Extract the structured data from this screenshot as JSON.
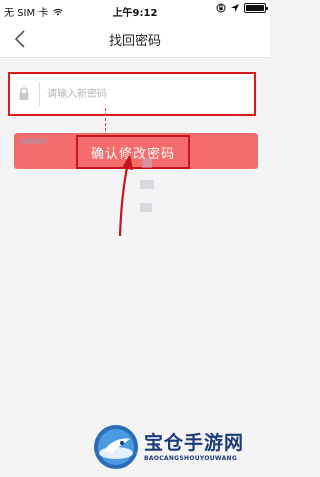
{
  "status_bar": {
    "carrier": "无 SIM 卡",
    "time": "上午9:12",
    "icons": [
      "wifi-icon",
      "rotation-lock-icon",
      "location-icon",
      "battery-icon"
    ]
  },
  "nav": {
    "back_icon": "chevron-left-icon",
    "title": "找回密码"
  },
  "password_field": {
    "icon": "lock-icon",
    "placeholder": "请输入新密码",
    "value": ""
  },
  "confirm_button": {
    "label": "确认修改密码"
  },
  "colors": {
    "button": "#f56c6c",
    "highlight": "#c4161c",
    "field_border": "#d91a1a"
  },
  "watermark": {
    "title": "宝仓手游网",
    "subtitle": "BAOCANGSHOUYOUWANG"
  }
}
